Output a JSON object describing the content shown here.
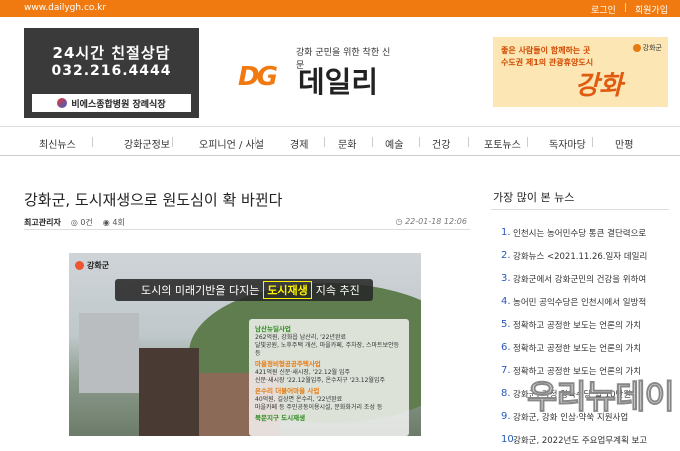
{
  "topbar": {
    "url": "www.dailygh.co.kr",
    "login": "로그인",
    "join": "회원가입"
  },
  "ad_left": {
    "line1": "24시간 친절상담",
    "line2": "032.216.4444",
    "brand": "비에스종합병원 장례식장"
  },
  "logo": {
    "tagline": "강화 군민을 위한 착한 신문",
    "mark": "DG",
    "name": "데일리"
  },
  "ad_right": {
    "line1": "좋은 사람들이 함께하는 곳",
    "line2": "수도권 제1의 관광휴양도시",
    "big": "강화",
    "seal": "강화군"
  },
  "nav": [
    "최신뉴스",
    "강화군정보",
    "오피니언 / 사설",
    "경제",
    "문화",
    "예술",
    "건강",
    "포토뉴스",
    "독자마당",
    "만평"
  ],
  "article": {
    "headline": "강화군, 도시재생으로 원도심이 확 바뀐다",
    "author": "최고관리자",
    "comments": "0건",
    "views": "4회",
    "date": "22-01-18 12:06"
  },
  "photo": {
    "logo": "강화군",
    "banner_pre": "도시의 미래기반을 다지는",
    "banner_hl": "도시재생",
    "banner_post": "지속 추진",
    "items": [
      {
        "h": "남산뉴딜사업",
        "d1": "262억원, 강화읍 남산리, '22년완료",
        "d2": "달빛공원, 노후주택 개선, 마을카페, 주차장, 스마트보안등 등"
      },
      {
        "h": "마을정비형공공주택사업",
        "d1": "421억원 신문·새시장, '22.12월 입주",
        "d2": "신문·새시장 '22.12월입주, 온수지구 '23.12월입주"
      },
      {
        "h": "온수리 더불어마을 사업",
        "d1": "40억원, 길상면 온수리, '22년완료",
        "d2": "마을카페 등 주민공동이용시설, 문화화거리 조성 등"
      },
      {
        "h": "북문지구 도시재생",
        "d1": "",
        "d2": ""
      }
    ]
  },
  "sidebar": {
    "title": "가장 많이 본 뉴스",
    "items": [
      "인천시는 농어민수당 통큰 결단력으로",
      "강화뉴스 <2021.11.26.일자 데일리",
      "강화군에서 강화군민의 건강을 위하여",
      "농어민 공익수당은 인천시에서 일방적",
      "정확하고 공정한 보도는 언론의 가치",
      "정확하고 공정한 보도는 언론의 가치",
      "정확하고 공정한 보도는 언론의 가치",
      "강화군, 가정 양육수당 월 10만원",
      "강화군, 강화 인삼·약쑥 지원사업",
      "강화군, 2022년도 주요업무계획 보고"
    ]
  },
  "watermark": "우리뉴데이"
}
